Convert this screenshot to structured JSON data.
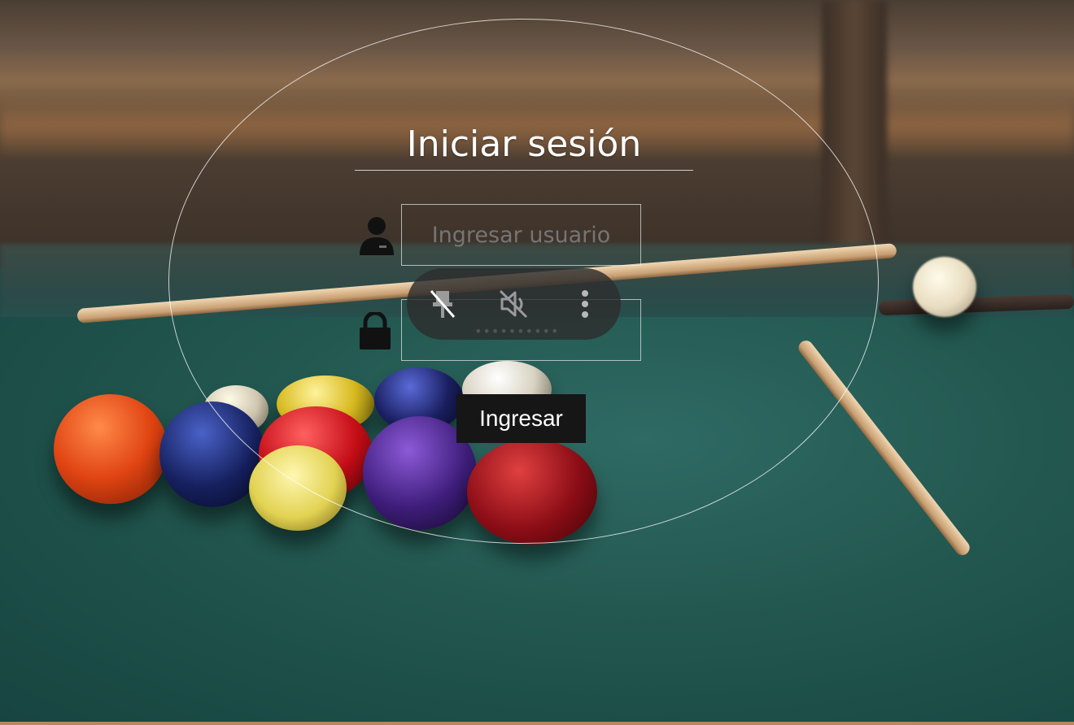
{
  "login": {
    "title": "Iniciar sesión",
    "username_placeholder": "Ingresar usuario",
    "password_mask": "••••••••••",
    "submit_label": "Ingresar"
  },
  "icons": {
    "user": "user-icon",
    "lock": "lock-icon",
    "pin": "unpin-icon",
    "mute": "mute-icon",
    "more": "more-vertical-icon"
  },
  "colors": {
    "button_bg": "#161616",
    "text": "#ffffff",
    "pill_bg": "#2d2d2d"
  }
}
